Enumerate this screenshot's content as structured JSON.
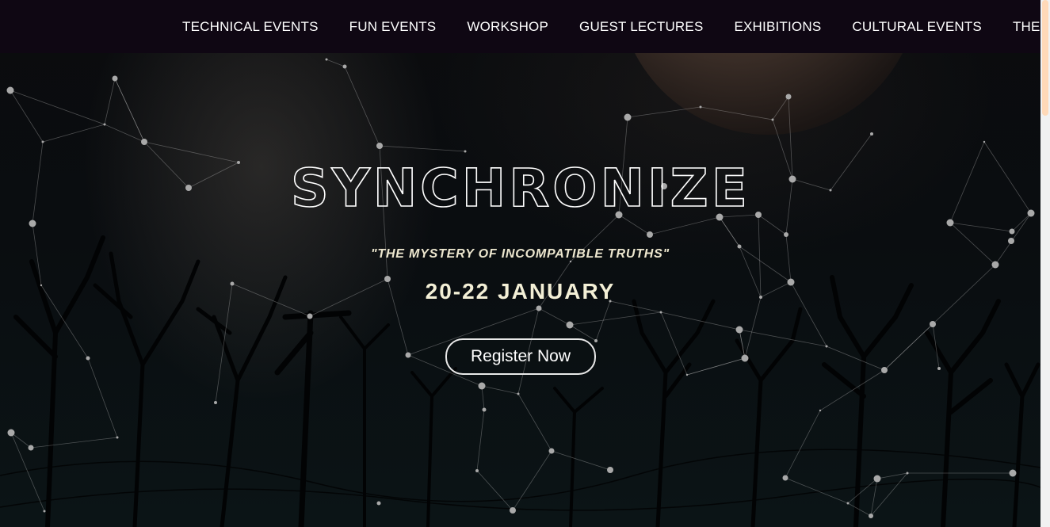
{
  "nav": {
    "items": [
      "TECHNICAL EVENTS",
      "FUN EVENTS",
      "WORKSHOP",
      "GUEST LECTURES",
      "EXHIBITIONS",
      "CULTURAL EVENTS",
      "THE TEAM"
    ]
  },
  "hero": {
    "title": "SYNCHRONIZE",
    "tagline": "\"THE MYSTERY OF INCOMPATIBLE TRUTHS\"",
    "dates": "20-22 JANUARY",
    "register_label": "Register Now"
  },
  "colors": {
    "navbar_bg": "#0f0713",
    "accent_text": "#f3efd6",
    "scroll_thumb": "#ffd9b8"
  }
}
